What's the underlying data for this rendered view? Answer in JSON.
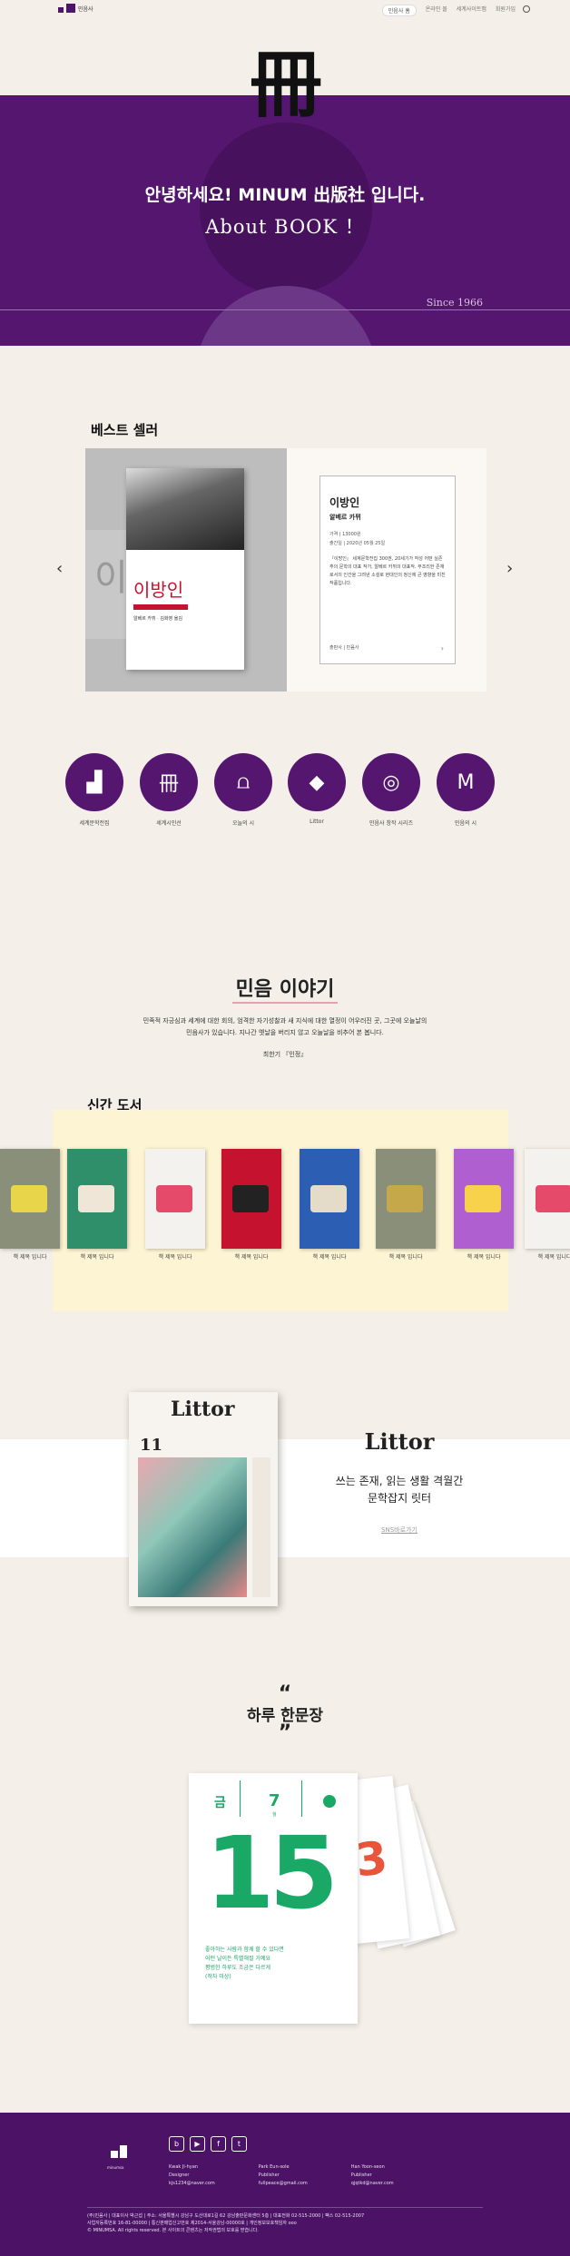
{
  "nav": {
    "brand": "민음사",
    "links": [
      "민음사 홈",
      "온라인 몰",
      "세계사이트맵",
      "회원가입"
    ],
    "search_icon": "search-icon"
  },
  "hero": {
    "glyph": "冊",
    "line1": "안녕하세요! MINUM 出版社 입니다.",
    "line2": "About BOOK ！",
    "since": "Since 1966"
  },
  "bestseller": {
    "title": "베스트 셀러",
    "book_title": "이방인",
    "book_author": "알베르 카뮈",
    "info": [
      "가격 | 13000원",
      "출간일 | 2020년 05월 25일"
    ],
    "desc": "『이방인』 세계문학전집 300권, 20세기가 작성 어떤 실존주의 문학의 대표 작가, 알베르 카뮈의 대표작. 부조리한 존재로서의 인간을 그려낸 소설로 현대인의 정신에 큰 영향을 미친 작품입니다.",
    "cover_label": "이방인",
    "cover_sub": "알베르 카뮈 · 김화영 옮김",
    "ghost_text": "이",
    "buy": "출판사 | 민음사",
    "buy_arrow": "›",
    "prev": "‹",
    "next": "›"
  },
  "categories": [
    {
      "label": "세계문학전집",
      "icon": "bars-icon"
    },
    {
      "label": "세계시인선",
      "icon": "book-glyph-icon"
    },
    {
      "label": "오늘의 시",
      "icon": "open-book-icon"
    },
    {
      "label": "Littor",
      "icon": "diamond-icon"
    },
    {
      "label": "민음사 창작 시리즈",
      "icon": "disc-icon"
    },
    {
      "label": "민음의 시",
      "icon": "mu-icon"
    }
  ],
  "category_glyphs": [
    "▟",
    "冊",
    "⩍",
    "◆",
    "◎",
    "M"
  ],
  "story": {
    "title": "민음 이야기",
    "line1": "민족적 자긍심과 세계에 대한 회의, 엄격한 자기성찰과 새 지식에 대한 열정이 어우러진 곳, 그곳에 오늘날의",
    "line2": "민음사가 있습니다. 지나간 옛날을 버리지 않고 오늘날을 비추어 본 봅니다.",
    "sign": "최한기 『인정』"
  },
  "newbooks": {
    "title": "신간 도서",
    "items": [
      {
        "label": "책 제목 입니다",
        "color": "#8a8f7a",
        "accent": "#e8d54a"
      },
      {
        "label": "책 제목 입니다",
        "color": "#2e8f6a",
        "accent": "#f0e6d8"
      },
      {
        "label": "책 제목 입니다",
        "color": "#f4f2ee",
        "accent": "#e64a6a"
      },
      {
        "label": "책 제목 입니다",
        "color": "#c4122f",
        "accent": "#222222"
      },
      {
        "label": "책 제목 입니다",
        "color": "#2c5fb3",
        "accent": "#e4dcc8"
      },
      {
        "label": "책 제목 입니다",
        "color": "#8a8f7a",
        "accent": "#c4a84a"
      },
      {
        "label": "책 제목 입니다",
        "color": "#b05fd0",
        "accent": "#f7d24a"
      },
      {
        "label": "책 제목 입니다",
        "color": "#f4f2ee",
        "accent": "#e64a6a"
      }
    ]
  },
  "littor": {
    "name": "Littor",
    "tag1": "쓰는 존재, 읽는 생활 격월간",
    "tag2": "문학잡지 릿터",
    "button": "SNS바로가기",
    "cover_title": "Littor",
    "cover_issue": "11"
  },
  "daily": {
    "quote_open": "“",
    "title": "하루 한문장",
    "quote_close": "”",
    "weekday": "금",
    "month": "7",
    "month_unit": "월",
    "day": "15",
    "lines": [
      "좋아하는 사람과 함께 할 수 있다면",
      "어떤 날이든 특별해질 거예요",
      "평범한 하루도 조금은 다르게",
      "(작자 미상)"
    ]
  },
  "footer": {
    "logo_text": "minumsa",
    "socials": [
      "blog-icon",
      "youtube-icon",
      "facebook-icon",
      "twitter-icon"
    ],
    "social_glyphs": [
      "b",
      "▶",
      "f",
      "t"
    ],
    "people": [
      {
        "name": "Kwak Ji-hyan",
        "role": "Designer",
        "email": "kjs1234@naver.com"
      },
      {
        "name": "Park Eun-sole",
        "role": "Publisher",
        "email": "fullpeace@gmail.com"
      },
      {
        "name": "Han Yoon-seon",
        "role": "Publisher",
        "email": "qjqtkd@naver.com"
      }
    ],
    "legal1": "(주)민음사 | 대표이사 박근섭 | 주소: 서울특별시 강남구 도산대로1길 62 강남출판문화센터 5층 | 대표전화 02-515-2000 | 팩스 02-515-2007",
    "legal2": "사업자등록번호 16-81-00000 | 통신판매업신고번호 제2014-서울강남-00000호 | 개인정보보호책임자 ooo",
    "legal3": "© MINUMSA. All rights reserved. 본 사이트의 콘텐츠는 저작권법의 보호를 받습니다."
  }
}
